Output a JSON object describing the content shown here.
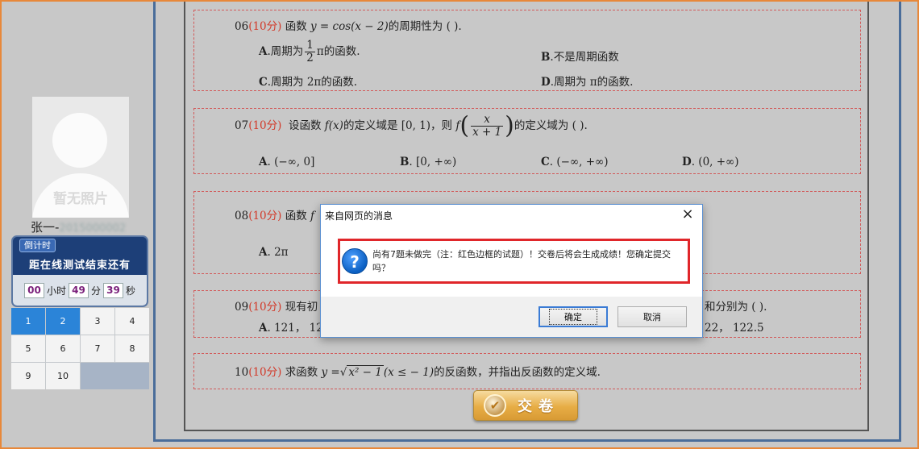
{
  "sidebar": {
    "photo_placeholder": "暂无照片",
    "student_name": "张一-",
    "student_id_blurred": "2015000002",
    "timer": {
      "tag": "倒计时",
      "title": "距在线测试结束还有",
      "hours": "00",
      "hours_unit": "小时",
      "minutes": "49",
      "minutes_unit": "分",
      "seconds": "39",
      "seconds_unit": "秒"
    },
    "question_nav": [
      {
        "label": "1",
        "done": true
      },
      {
        "label": "2",
        "done": true
      },
      {
        "label": "3",
        "done": false
      },
      {
        "label": "4",
        "done": false
      },
      {
        "label": "5",
        "done": false
      },
      {
        "label": "6",
        "done": false
      },
      {
        "label": "7",
        "done": false
      },
      {
        "label": "8",
        "done": false
      },
      {
        "label": "9",
        "done": false
      },
      {
        "label": "10",
        "done": false
      }
    ]
  },
  "questions": {
    "q06": {
      "num": "06",
      "score": "(10分)",
      "stem_a": "函数",
      "stem_formula": "y = cos(x − 2)",
      "stem_b": "的周期性为 ( ).",
      "opt_a_label": "A",
      "opt_a_pre": ".周期为",
      "opt_a_frac_n": "1",
      "opt_a_frac_d": "2",
      "opt_a_post": "π的函数.",
      "opt_b_label": "B",
      "opt_b": ".不是周期函数",
      "opt_c_label": "C",
      "opt_c": ".周期为 2π的函数.",
      "opt_d_label": "D",
      "opt_d": ".周期为 π的函数."
    },
    "q07": {
      "num": "07",
      "score": "(10分)",
      "stem_a": "设函数",
      "stem_fx": "f(x)",
      "stem_b": "的定义域是 [0, 1)，则",
      "stem_f": "f",
      "frac_n": "x",
      "frac_d": "x + 1",
      "stem_c": "的定义域为 ( ).",
      "opt_a_label": "A",
      "opt_a": ". (−∞, 0]",
      "opt_b_label": "B",
      "opt_b": ". [0, +∞)",
      "opt_c_label": "C",
      "opt_c": ". (−∞, +∞)",
      "opt_d_label": "D",
      "opt_d": ". (0, +∞)"
    },
    "q08": {
      "num": "08",
      "score": "(10分)",
      "stem_a": "函数",
      "stem_partial": "f",
      "opt_a_label": "A",
      "opt_a": ". 2π"
    },
    "q09": {
      "num": "09",
      "score": "(10分)",
      "stem_a": "现有初",
      "stem_end": "和分别为 ( ).",
      "opt_a_label": "A",
      "opt_a": ". 121， 12",
      "opt_end": "22， 122.5"
    },
    "q10": {
      "num": "10",
      "score": "(10分)",
      "stem_a": "求函数",
      "stem_y": "y =",
      "stem_sqrt": "x² − 1",
      "stem_cond": "(x ≤ − 1)",
      "stem_b": "的反函数，并指出反函数的定义域."
    }
  },
  "submit": {
    "icon": "✔",
    "label": "交卷"
  },
  "dialog": {
    "title": "来自网页的消息",
    "close_icon": "×",
    "icon": "?",
    "message": "尚有7题未做完（注：红色边框的试题）！交卷后将会生成成绩！您确定提交吗？",
    "ok_label": "确定",
    "cancel_label": "取消"
  }
}
